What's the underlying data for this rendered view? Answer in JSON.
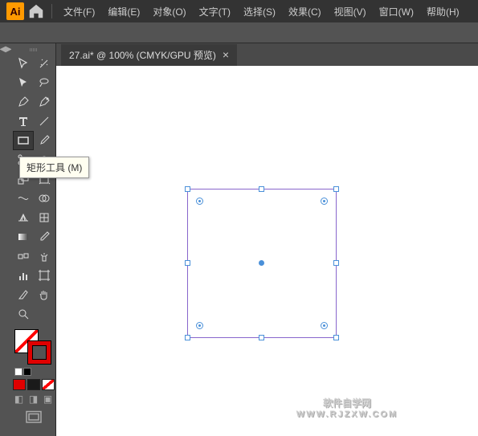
{
  "app": {
    "logo": "Ai"
  },
  "menu": [
    "文件(F)",
    "编辑(E)",
    "对象(O)",
    "文字(T)",
    "选择(S)",
    "效果(C)",
    "视图(V)",
    "窗口(W)",
    "帮助(H)"
  ],
  "tab": {
    "label": "27.ai* @ 100% (CMYK/GPU 预览)"
  },
  "tooltip": {
    "text": "矩形工具 (M)"
  },
  "colors": {
    "red": "#e00000",
    "black": "#1a1a1a",
    "white": "#ffffff",
    "none_stroke": "#888"
  },
  "watermark": {
    "main": "软件自学网",
    "sub": "WWW.RJZXW.COM"
  }
}
